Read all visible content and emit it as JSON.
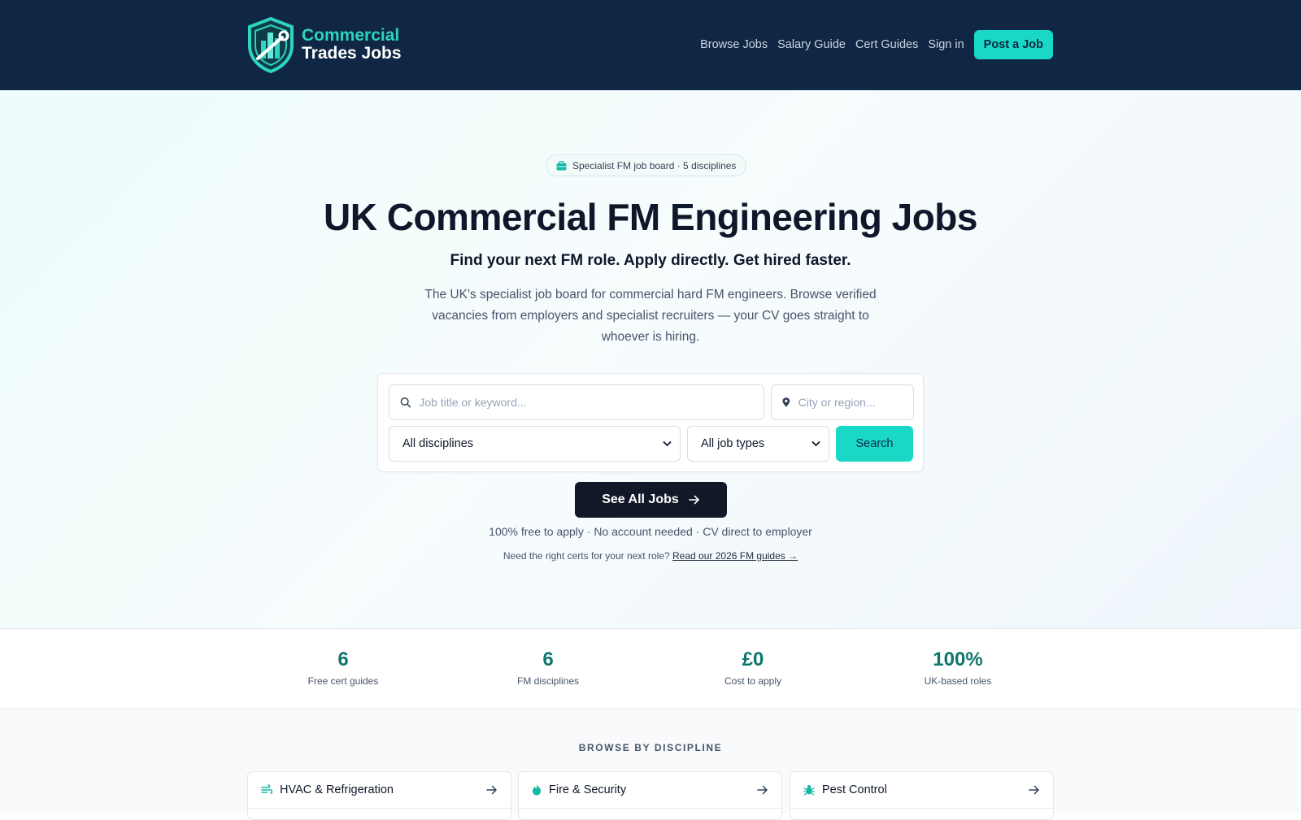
{
  "brand": {
    "line1": "Commercial",
    "line2": "Trades Jobs"
  },
  "nav": {
    "items": [
      "Browse Jobs",
      "Salary Guide",
      "Cert Guides",
      "Sign in"
    ],
    "post_job": "Post a Job"
  },
  "hero": {
    "pill": "Specialist FM job board · 5 disciplines",
    "title": "UK Commercial FM Engineering Jobs",
    "subtitle": "Find your next FM role. Apply directly. Get hired faster.",
    "lead": "The UK's specialist job board for commercial hard FM engineers. Browse verified vacancies from employers and specialist recruiters — your CV goes straight to whoever is hiring."
  },
  "search": {
    "keyword_placeholder": "Job title or keyword...",
    "location_placeholder": "City or region...",
    "discipline_selected": "All disciplines",
    "jobtype_selected": "All job types",
    "button": "Search"
  },
  "cta": {
    "see_all": "See All Jobs",
    "free_note": "100% free to apply · No account needed · CV direct to employer",
    "cert_prefix": "Need the right certs for your next role?",
    "cert_link": "Read our 2026 FM guides →"
  },
  "stats": [
    {
      "value": "6",
      "label": "Free cert guides"
    },
    {
      "value": "6",
      "label": "FM disciplines"
    },
    {
      "value": "£0",
      "label": "Cost to apply"
    },
    {
      "value": "100%",
      "label": "UK-based roles"
    }
  ],
  "browse": {
    "title": "BROWSE BY DISCIPLINE",
    "disciplines": [
      {
        "label": "HVAC & Refrigeration",
        "icon": "fan-icon"
      },
      {
        "label": "Fire & Security",
        "icon": "flame-icon"
      },
      {
        "label": "Pest Control",
        "icon": "bug-icon"
      }
    ]
  },
  "colors": {
    "navy": "#0f2744",
    "teal": "#19d8c5",
    "dark": "#111827",
    "stat_teal": "#0f766e"
  }
}
